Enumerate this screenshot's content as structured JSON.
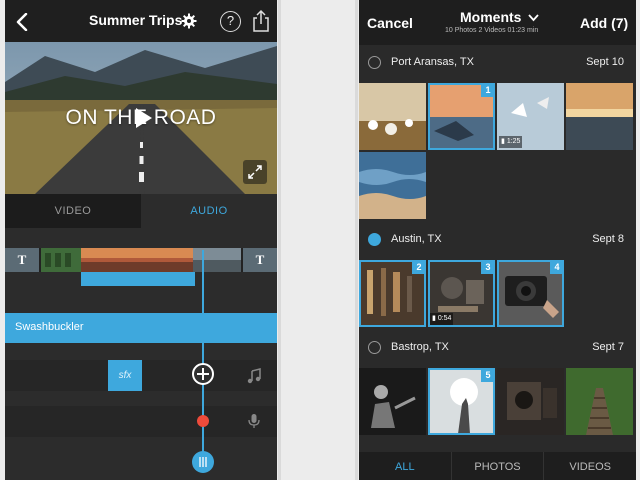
{
  "editor": {
    "project_title": "Summer Trips",
    "help_label": "?",
    "overlay_text": "ON THE ROAD",
    "tabs": {
      "video": "VIDEO",
      "audio": "AUDIO"
    },
    "title_clip_glyph": "T",
    "music_track_name": "Swashbuckler",
    "sfx_label": "sfx",
    "accent_color": "#3ea8dd",
    "record_color": "#ee4b3b"
  },
  "picker": {
    "cancel_label": "Cancel",
    "title": "Moments",
    "subtitle": "10 Photos  2 Videos  01:23 min",
    "add_label": "Add (7)",
    "sections": [
      {
        "place": "Port Aransas, TX",
        "date": "Sept 10",
        "selected": false
      },
      {
        "place": "Austin, TX",
        "date": "Sept 8",
        "selected": true
      },
      {
        "place": "Bastrop, TX",
        "date": "Sept 7",
        "selected": false
      }
    ],
    "badges": [
      "1",
      "2",
      "3",
      "4",
      "5"
    ],
    "durations": [
      "1:25",
      "0:54"
    ],
    "bottom_tabs": {
      "all": "ALL",
      "photos": "PHOTOS",
      "videos": "VIDEOS"
    }
  }
}
